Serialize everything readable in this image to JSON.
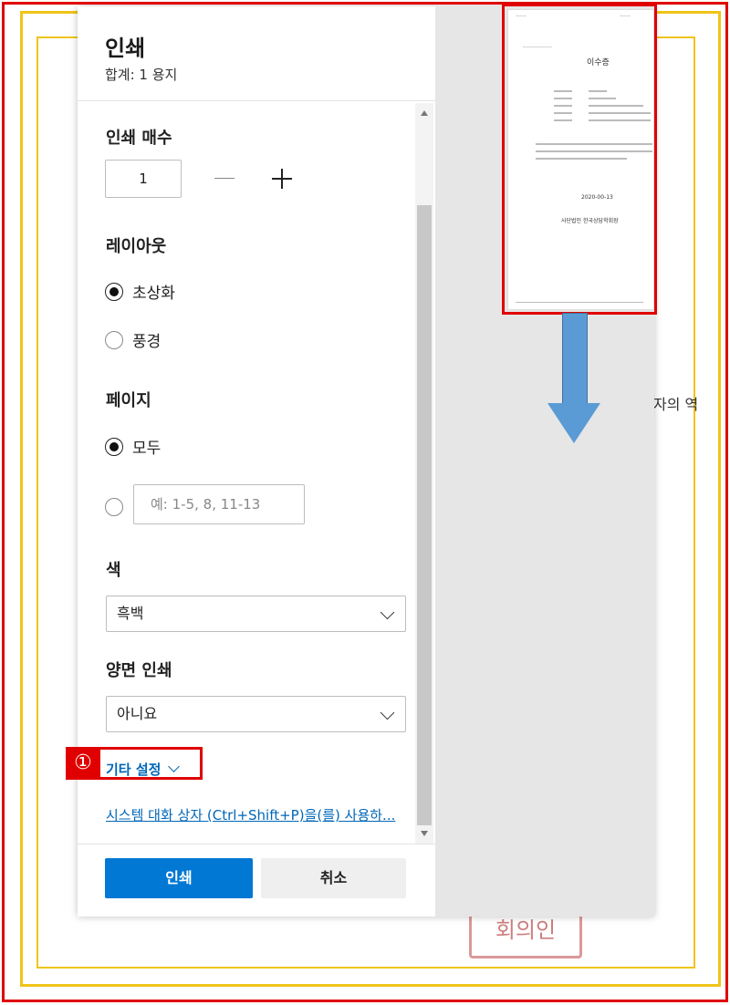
{
  "background": {
    "text_right": "자의 역",
    "seal_text": "회의인"
  },
  "dialog": {
    "title": "인쇄",
    "subtitle": "합계: 1 용지",
    "copies": {
      "label": "인쇄 매수",
      "value": "1"
    },
    "layout": {
      "label": "레이아웃",
      "options": [
        "초상화",
        "풍경"
      ],
      "selected": "초상화"
    },
    "pages": {
      "label": "페이지",
      "all_label": "모두",
      "custom_placeholder": "예: 1-5, 8, 11-13",
      "selected": "모두"
    },
    "color": {
      "label": "색",
      "value": "흑백"
    },
    "duplex": {
      "label": "양면 인쇄",
      "value": "아니요"
    },
    "more_settings": "기타 설정",
    "annotation_number": "①",
    "system_dialog_link": "시스템 대화 상자 (Ctrl+Shift+P)을(를) 사용하...",
    "print_button": "인쇄",
    "cancel_button": "취소"
  },
  "preview": {
    "page_title": "이수증",
    "date": "2020-00-13",
    "issuer": "사단법인 한국상담학회장"
  },
  "colors": {
    "accent": "#0078d4",
    "link": "#0067b8",
    "highlight": "#e00000",
    "arrow": "#5b9bd5",
    "frame_gold": "#f0c419"
  }
}
